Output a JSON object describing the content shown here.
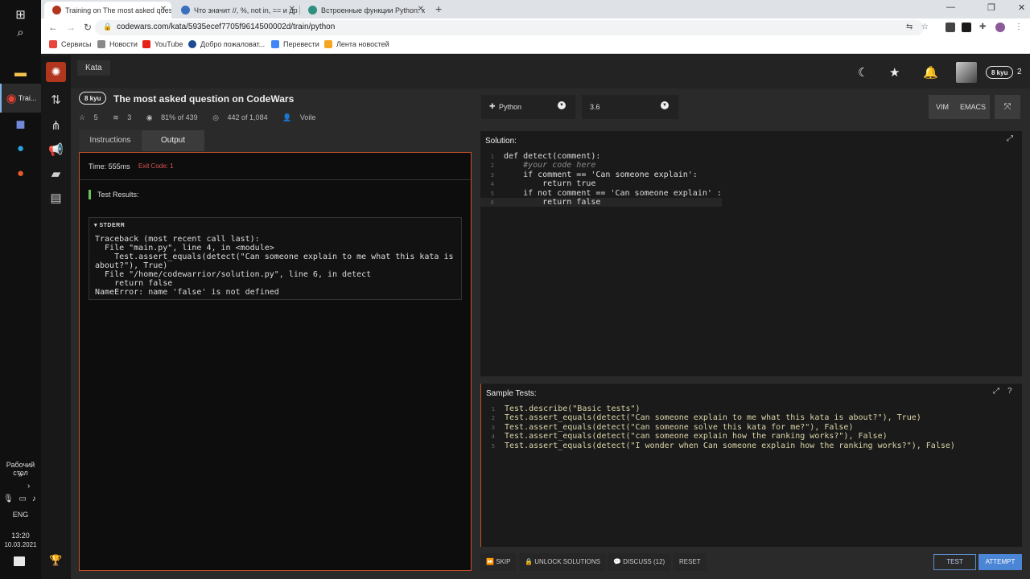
{
  "browser": {
    "tabs": [
      {
        "title": "Training on The most asked ques",
        "fav_color": "#b1361e",
        "active": true
      },
      {
        "title": "Что значит //, %, not in, == и др",
        "fav_color": "#3a6fbf",
        "active": false
      },
      {
        "title": "Встроенные функции Python: к",
        "fav_color": "#2f8f80",
        "active": false
      }
    ],
    "url": "codewars.com/kata/5935ecef7705f9614500002d/train/python",
    "bookmarks": [
      {
        "label": "Сервисы",
        "color": "#e8453c"
      },
      {
        "label": "Новости",
        "color": "#888888"
      },
      {
        "label": "YouTube",
        "color": "#e62117"
      },
      {
        "label": "Добро пожаловат...",
        "color": "#1d4b8f"
      },
      {
        "label": "Перевести",
        "color": "#4285f4"
      },
      {
        "label": "Лента новостей",
        "color": "#f5a623"
      }
    ]
  },
  "taskbar": {
    "chrome_label": "Trai...",
    "desktop_label": "Рабочий стол",
    "lang": "ENG",
    "time": "13:20",
    "date": "10.03.2021"
  },
  "header": {
    "crumb": "Kata",
    "rank": "8 kyu",
    "honor": "2"
  },
  "kata": {
    "rank": "8 kyu",
    "title": "The most asked question on CodeWars",
    "stars": "5",
    "collections": "3",
    "satisfaction": "81% of 439",
    "completed": "442 of 1,084",
    "author": "Voile"
  },
  "tabs": {
    "instructions": "Instructions",
    "output": "Output"
  },
  "output": {
    "time": "Time: 555ms",
    "exit_code": "Exit Code: 1",
    "test_results": "Test Results:",
    "stderr_label": "STDERR",
    "stderr_text": "Traceback (most recent call last):\n  File \"main.py\", line 4, in <module>\n    Test.assert_equals(detect(\"Can someone explain to me what this kata is\nabout?\"), True)\n  File \"/home/codewarrior/solution.py\", line 6, in detect\n    return false\nNameError: name 'false' is not defined"
  },
  "editor": {
    "language": "Python",
    "version": "3.6",
    "vim": "VIM",
    "emacs": "EMACS"
  },
  "solution": {
    "title": "Solution:",
    "lines": [
      "def detect(comment):",
      "    #your code here",
      "    if comment == 'Can someone explain':",
      "        return true",
      "    if not comment == 'Can someone explain' :",
      "        return false"
    ]
  },
  "sample_tests": {
    "title": "Sample Tests:",
    "lines": [
      "Test.describe(\"Basic tests\")",
      "Test.assert_equals(detect(\"Can someone explain to me what this kata is about?\"), True)",
      "Test.assert_equals(detect(\"Can someone solve this kata for me?\"), False)",
      "Test.assert_equals(detect(\"can someone explain how the ranking works?\"), False)",
      "Test.assert_equals(detect(\"I wonder when Can someone explain how the ranking works?\"), False)"
    ]
  },
  "footer": {
    "skip": "SKIP",
    "unlock": "UNLOCK SOLUTIONS",
    "discuss": "DISCUSS (12)",
    "reset": "RESET",
    "test": "TEST",
    "attempt": "ATTEMPT"
  }
}
